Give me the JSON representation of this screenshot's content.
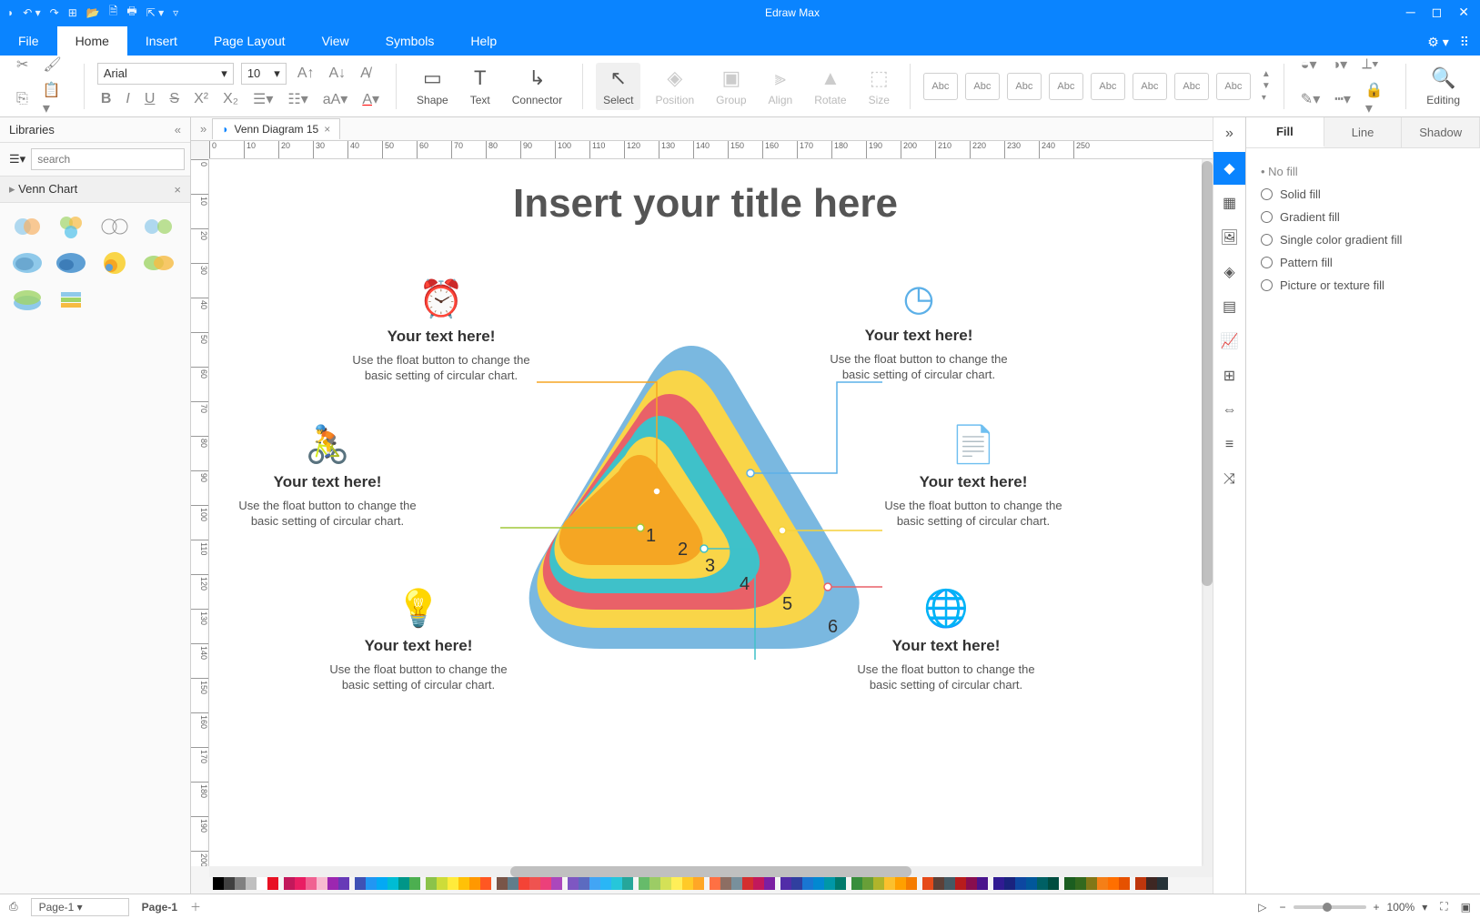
{
  "app": {
    "title": "Edraw Max"
  },
  "menu": {
    "tabs": [
      "File",
      "Home",
      "Insert",
      "Page Layout",
      "View",
      "Symbols",
      "Help"
    ],
    "active": 1
  },
  "ribbon": {
    "font_name": "Arial",
    "font_size": "10",
    "buttons": {
      "shape": "Shape",
      "text": "Text",
      "connector": "Connector",
      "select": "Select",
      "position": "Position",
      "group": "Group",
      "align": "Align",
      "rotate": "Rotate",
      "size": "Size",
      "editing": "Editing"
    },
    "style_label": "Abc",
    "style_count": 8
  },
  "libraries": {
    "title": "Libraries",
    "search_placeholder": "search",
    "section": "Venn Chart"
  },
  "document": {
    "tab": "Venn Diagram 15"
  },
  "canvas": {
    "title": "Insert your title here",
    "callouts": [
      {
        "heading": "Your text here!",
        "body": "Use the float button to change the basic setting of circular chart.",
        "color": "#f5a623"
      },
      {
        "heading": "Your text here!",
        "body": "Use the float button to change the basic setting of circular chart.",
        "color": "#5cb0e8"
      },
      {
        "heading": "Your text here!",
        "body": "Use the float button to change the basic setting of circular chart.",
        "color": "#a0c93a"
      },
      {
        "heading": "Your text here!",
        "body": "Use the float button to change the basic setting of circular chart.",
        "color": "#f5d13a"
      },
      {
        "heading": "Your text here!",
        "body": "Use the float button to change the basic setting of circular chart.",
        "color": "#3fc1c9"
      },
      {
        "heading": "Your text here!",
        "body": "Use the float button to change the basic setting of circular chart.",
        "color": "#e96168"
      }
    ],
    "layers": [
      {
        "num": "1",
        "color": "#f5a623"
      },
      {
        "num": "2",
        "color": "#3fc1c9"
      },
      {
        "num": "3",
        "color": "#e96168"
      },
      {
        "num": "4",
        "color": "#f9d548"
      },
      {
        "num": "5",
        "color": "#7ab8e0"
      },
      {
        "num": "6",
        "color": "#5e9fd4"
      }
    ]
  },
  "props": {
    "tabs": [
      "Fill",
      "Line",
      "Shadow"
    ],
    "active": 0,
    "options": [
      "No fill",
      "Solid fill",
      "Gradient fill",
      "Single color gradient fill",
      "Pattern fill",
      "Picture or texture fill"
    ]
  },
  "statusbar": {
    "page_dropdown": "Page-1",
    "page_label": "Page-1",
    "zoom": "100%"
  },
  "ruler_start": 0,
  "ruler_step": 10,
  "ruler_count_h": 26,
  "ruler_count_v": 21,
  "color_palette": [
    "#000000",
    "#404040",
    "#808080",
    "#c0c0c0",
    "#ffffff",
    "#e81123",
    "#c2185b",
    "#e91e63",
    "#f06292",
    "#f8bbd0",
    "#9c27b0",
    "#673ab7",
    "#3f51b5",
    "#2196f3",
    "#03a9f4",
    "#00bcd4",
    "#009688",
    "#4caf50",
    "#8bc34a",
    "#cddc39",
    "#ffeb3b",
    "#ffc107",
    "#ff9800",
    "#ff5722",
    "#795548",
    "#607d8b",
    "#f44336",
    "#ef5350",
    "#ec407a",
    "#ab47bc",
    "#7e57c2",
    "#5c6bc0",
    "#42a5f5",
    "#29b6f6",
    "#26c6da",
    "#26a69a",
    "#66bb6a",
    "#9ccc65",
    "#d4e157",
    "#ffee58",
    "#ffca28",
    "#ffa726",
    "#ff7043",
    "#8d6e63",
    "#78909c",
    "#d32f2f",
    "#c2185b",
    "#7b1fa2",
    "#512da8",
    "#303f9f",
    "#1976d2",
    "#0288d1",
    "#0097a7",
    "#00796b",
    "#388e3c",
    "#689f38",
    "#afb42b",
    "#fbc02d",
    "#ffa000",
    "#f57c00",
    "#e64a19",
    "#5d4037",
    "#455a64",
    "#b71c1c",
    "#880e4f",
    "#4a148c",
    "#311b92",
    "#1a237e",
    "#0d47a1",
    "#01579b",
    "#006064",
    "#004d40",
    "#1b5e20",
    "#33691e",
    "#827717",
    "#f57f17",
    "#ff6f00",
    "#e65100",
    "#bf360c",
    "#3e2723",
    "#263238"
  ]
}
